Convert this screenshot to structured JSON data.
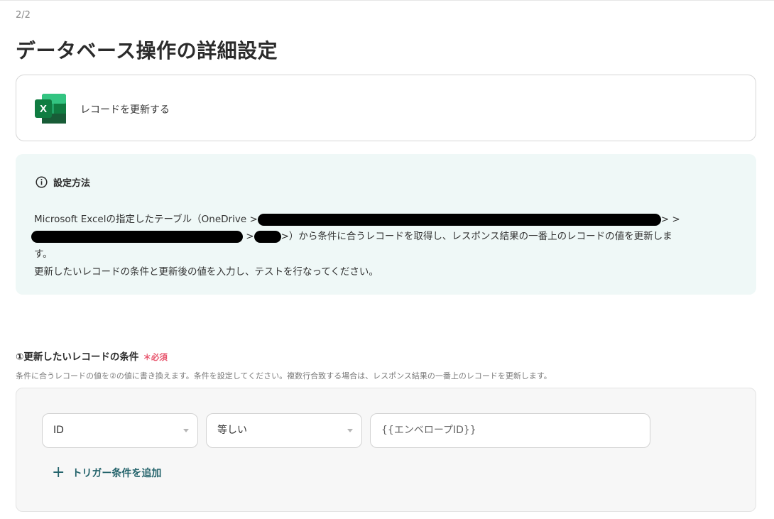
{
  "header": {
    "step": "2/2",
    "title": "データベース操作の詳細設定"
  },
  "action": {
    "icon": "excel-icon",
    "label": "レコードを更新する"
  },
  "info": {
    "icon": "info-circle-icon",
    "title": "設定方法",
    "line1_prefix": "Microsoft Excelの指定したテーブル（OneDrive >",
    "line1_suffix": "> >",
    "line2_sep": ">",
    "line2_rest": ">）から条件に合うレコードを取得し、レスポンス結果の一番上のレコードの値を更新しま",
    "line3": "す。",
    "line4": "更新したいレコードの条件と更新後の値を入力し、テストを行なってください。"
  },
  "condition": {
    "label": "①更新したいレコードの条件",
    "required": "＊必須",
    "description": "条件に合うレコードの値を②の値に書き換えます。条件を設定してください。複数行合致する場合は、レスポンス結果の一番上のレコードを更新します。",
    "field_select": "ID",
    "operator_select": "等しい",
    "value_input": "{{エンベロープID}}",
    "add_trigger": "トリガー条件を追加"
  },
  "colors": {
    "accent": "#24636b",
    "required": "#e8566e",
    "info_bg": "#eff8f7",
    "excel_green": "#107c41"
  }
}
